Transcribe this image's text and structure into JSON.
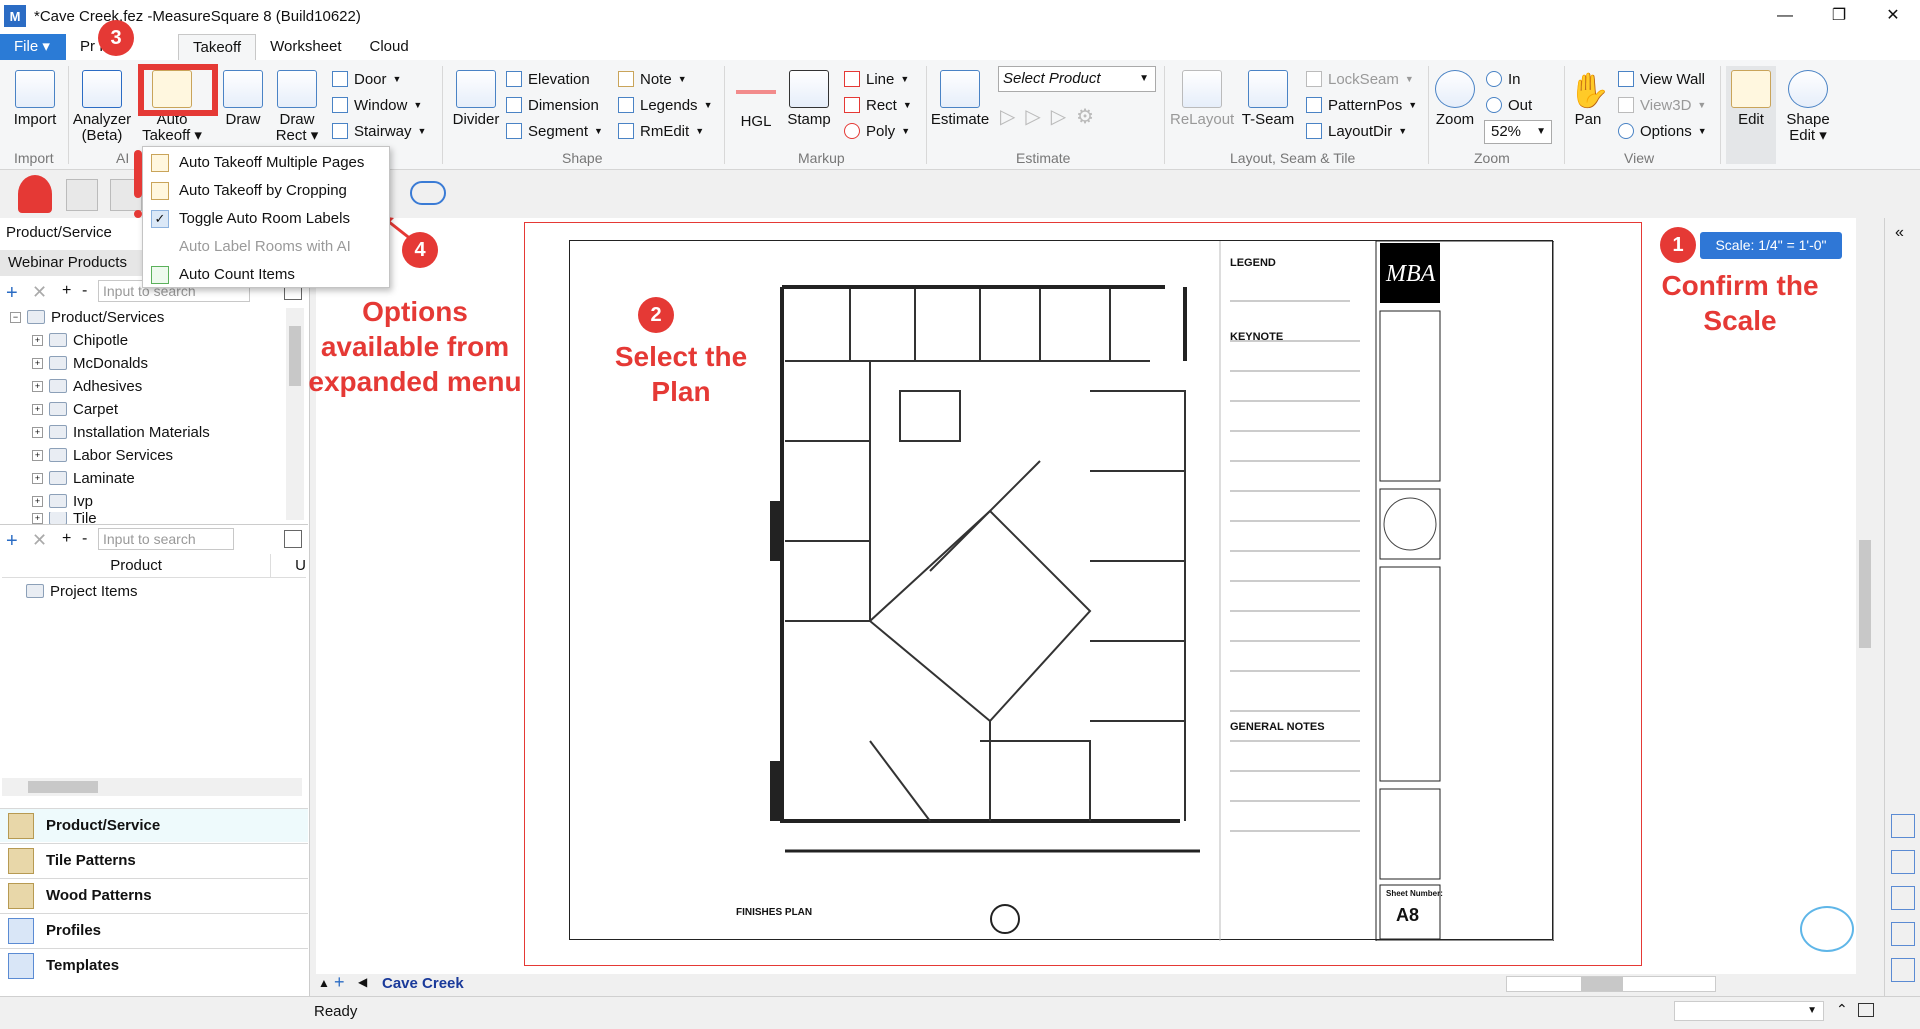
{
  "window": {
    "title": "*Cave Creek.fez -MeasureSquare 8 (Build10622)",
    "minimize": "—",
    "maximize": "❐",
    "close": "✕"
  },
  "tabs": {
    "file": "File ▾",
    "items": [
      "Project Info",
      "Takeoff",
      "Worksheet",
      "Cloud"
    ],
    "project_info_visible": "Pr     Info"
  },
  "ribbon": {
    "import": "Import",
    "analyzer": "Analyzer",
    "analyzer_sub": "(Beta)",
    "auto_takeoff": "Auto",
    "auto_takeoff_2": "Takeoff ▾",
    "draw": "Draw",
    "draw_rect": "Draw",
    "draw_rect_2": "Rect ▾",
    "door": "Door",
    "window": "Window",
    "stairway": "Stairway",
    "divider": "Divider",
    "elevation": "Elevation",
    "dimension": "Dimension",
    "segment": "Segment",
    "note": "Note",
    "legends": "Legends",
    "rmedit": "RmEdit",
    "hgl": "HGL",
    "stamp": "Stamp",
    "line": "Line",
    "rect": "Rect",
    "poly": "Poly",
    "estimate": "Estimate",
    "select_product": "Select Product",
    "relayout": "ReLayout",
    "tseam": "T-Seam",
    "lockseam": "LockSeam",
    "patternpos": "PatternPos",
    "layoutdir": "LayoutDir",
    "zoom": "Zoom",
    "zoom_in": "In",
    "zoom_out": "Out",
    "zoom_level": "52%",
    "pan": "Pan",
    "view_wall": "View Wall",
    "view3d": "View3D",
    "options": "Options",
    "edit": "Edit",
    "shape_edit": "Shape",
    "shape_edit_2": "Edit ▾",
    "groups": {
      "import": "Import",
      "ai": "AI",
      "shape": "Shape",
      "markup": "Markup",
      "estimate": "Estimate",
      "layout": "Layout, Seam & Tile",
      "zoom": "Zoom",
      "view": "View"
    }
  },
  "dropdown": {
    "items": [
      {
        "label": "Auto Takeoff Multiple Pages"
      },
      {
        "label": "Auto Takeoff by Cropping"
      },
      {
        "label": "Toggle Auto Room Labels"
      },
      {
        "label": "Auto Label Rooms with AI"
      },
      {
        "label": "Auto Count Items"
      }
    ]
  },
  "left_panel": {
    "header": "Product/Service",
    "subheader": "Webinar Products",
    "search_placeholder": "Input to search",
    "search_placeholder_2": "Input to search",
    "tree_root": "Product/Services",
    "tree_items": [
      "Chipotle",
      "McDonalds",
      "Adhesives",
      "Carpet",
      "Installation Materials",
      "Labor Services",
      "Laminate",
      "Ivp",
      "Tile"
    ],
    "grid_header_product": "Product",
    "grid_header_u": "U",
    "project_items": "Project Items",
    "nav": [
      "Product/Service",
      "Tile Patterns",
      "Wood Patterns",
      "Profiles",
      "Templates"
    ]
  },
  "annotations": {
    "badge1": "1",
    "badge2": "2",
    "badge3": "3",
    "badge4": "4",
    "confirm_scale": "Confirm the Scale",
    "select_plan": "Select the Plan",
    "options_menu": "Options available from expanded menu"
  },
  "canvas": {
    "scale_label": "Scale: 1/4\" = 1'-0\"",
    "plan_title": "FINISHES PLAN",
    "sheet_number_label": "Sheet Number:",
    "sheet_number": "A8",
    "legend": "LEGEND",
    "keynote": "KEYNOTE",
    "general_notes": "GENERAL NOTES",
    "logo": "MBA"
  },
  "bottom": {
    "tab": "Cave Creek",
    "status": "Ready"
  }
}
